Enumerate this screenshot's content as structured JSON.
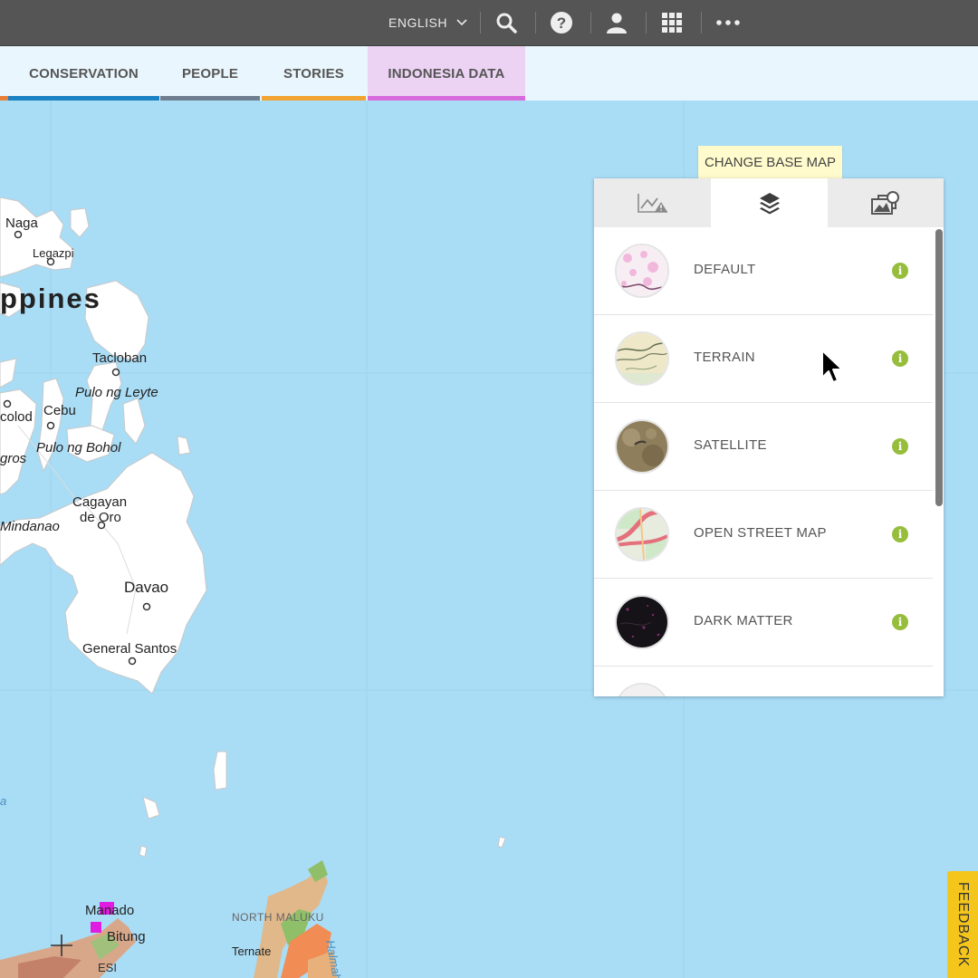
{
  "topbar": {
    "language": "ENGLISH",
    "icons": [
      "search-icon",
      "help-icon",
      "user-icon",
      "apps-grid-icon",
      "more-icon"
    ]
  },
  "nav": {
    "tabs": [
      {
        "label": "CONSERVATION",
        "color": "#1b82c4"
      },
      {
        "label": "PEOPLE",
        "color": "#6f7f91"
      },
      {
        "label": "STORIES",
        "color": "#f2a332"
      },
      {
        "label": "INDONESIA DATA",
        "color": "#d86bdc"
      }
    ],
    "active_tab_bg": "#e9c8f2"
  },
  "map": {
    "places": {
      "naga": "Naga",
      "legazpi": "Legazpi",
      "philippines": "ppines",
      "tacloban": "Tacloban",
      "pulo_leyte": "Pulo ng Leyte",
      "bacolod": "colod",
      "cebu": "Cebu",
      "pulo_bohol": "Pulo ng Bohol",
      "negros": "gros",
      "cagayan_1": "Cagayan",
      "cagayan_2": "de Oro",
      "mindanao": "Mindanao",
      "davao": "Davao",
      "general_santos": "General Santos",
      "manado": "Manado",
      "bitung": "Bitung",
      "north_maluku": "NORTH MALUKU",
      "ternate": "Ternate",
      "halmahera": "Halmahe",
      "sulawesi": "ESI",
      "sea_left": "a"
    }
  },
  "tooltip": "CHANGE BASE MAP",
  "panel": {
    "tabs": [
      {
        "icon": "chart-alert-icon"
      },
      {
        "icon": "layers-icon",
        "active": true
      },
      {
        "icon": "image-stack-icon"
      }
    ],
    "basemaps": [
      {
        "label": "DEFAULT",
        "thumb": "default"
      },
      {
        "label": "TERRAIN",
        "thumb": "terrain"
      },
      {
        "label": "SATELLITE",
        "thumb": "satellite"
      },
      {
        "label": "OPEN STREET MAP",
        "thumb": "osm"
      },
      {
        "label": "DARK MATTER",
        "thumb": "dark"
      },
      {
        "label": "",
        "thumb": "partial"
      }
    ],
    "info_color": "#97bd3d"
  },
  "feedback": "FEEDBACK",
  "colors": {
    "topbar": "#555555",
    "sea": "#a9dcf5",
    "land": "#ffffff",
    "feedback": "#f4c51b"
  }
}
